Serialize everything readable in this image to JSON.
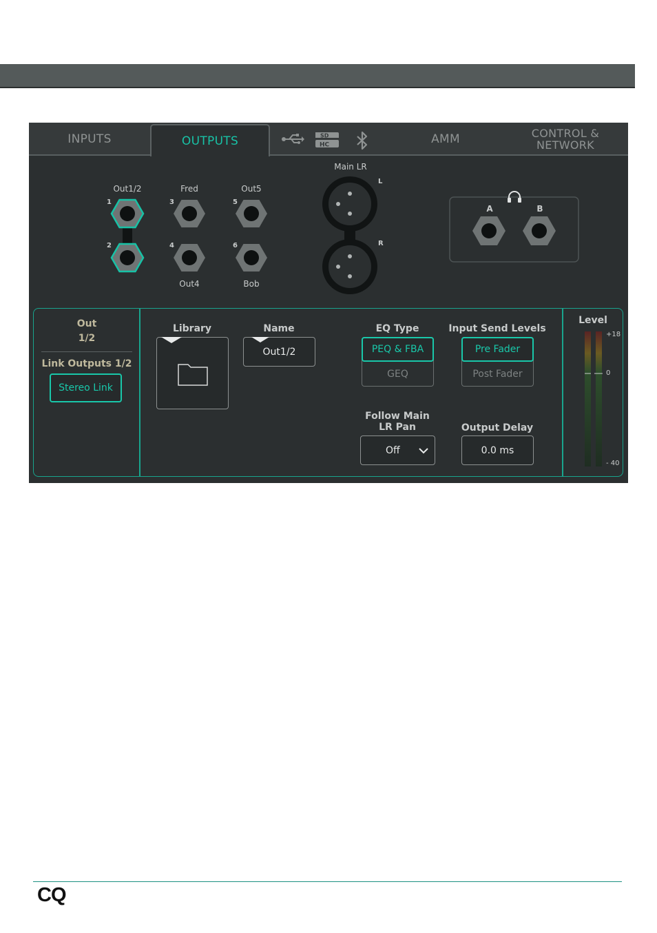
{
  "tabs": {
    "inputs": "INPUTS",
    "outputs": "OUTPUTS",
    "amm": "AMM",
    "control_line1": "CONTROL &",
    "control_line2": "NETWORK"
  },
  "sockets": {
    "out12": "Out1/2",
    "fred": "Fred",
    "out5": "Out5",
    "out4": "Out4",
    "bob": "Bob",
    "n1": "1",
    "n2": "2",
    "n3": "3",
    "n4": "4",
    "n5": "5",
    "n6": "6",
    "main_lr": "Main LR",
    "left": "L",
    "right": "R",
    "phones_a": "A",
    "phones_b": "B"
  },
  "channel": {
    "out_line1": "Out",
    "out_line2": "1/2",
    "link_title": "Link Outputs 1/2",
    "stereo_link": "Stereo Link"
  },
  "library": {
    "title": "Library"
  },
  "name": {
    "title": "Name",
    "value": "Out1/2"
  },
  "eq": {
    "title": "EQ Type",
    "peq": "PEQ & FBA",
    "geq": "GEQ"
  },
  "send": {
    "title": "Input Send Levels",
    "pre": "Pre Fader",
    "post": "Post Fader"
  },
  "pan": {
    "title_line1": "Follow Main",
    "title_line2": "LR Pan",
    "value": "Off"
  },
  "delay": {
    "title": "Output Delay",
    "value": "0.0 ms"
  },
  "level": {
    "title": "Level",
    "top": "+18",
    "mid": "0",
    "bottom": "- 40"
  },
  "footer": {
    "logo": "CQ"
  },
  "colors": {
    "accent": "#18c2a6",
    "panel": "#2b2f30",
    "header": "#545a5a"
  }
}
